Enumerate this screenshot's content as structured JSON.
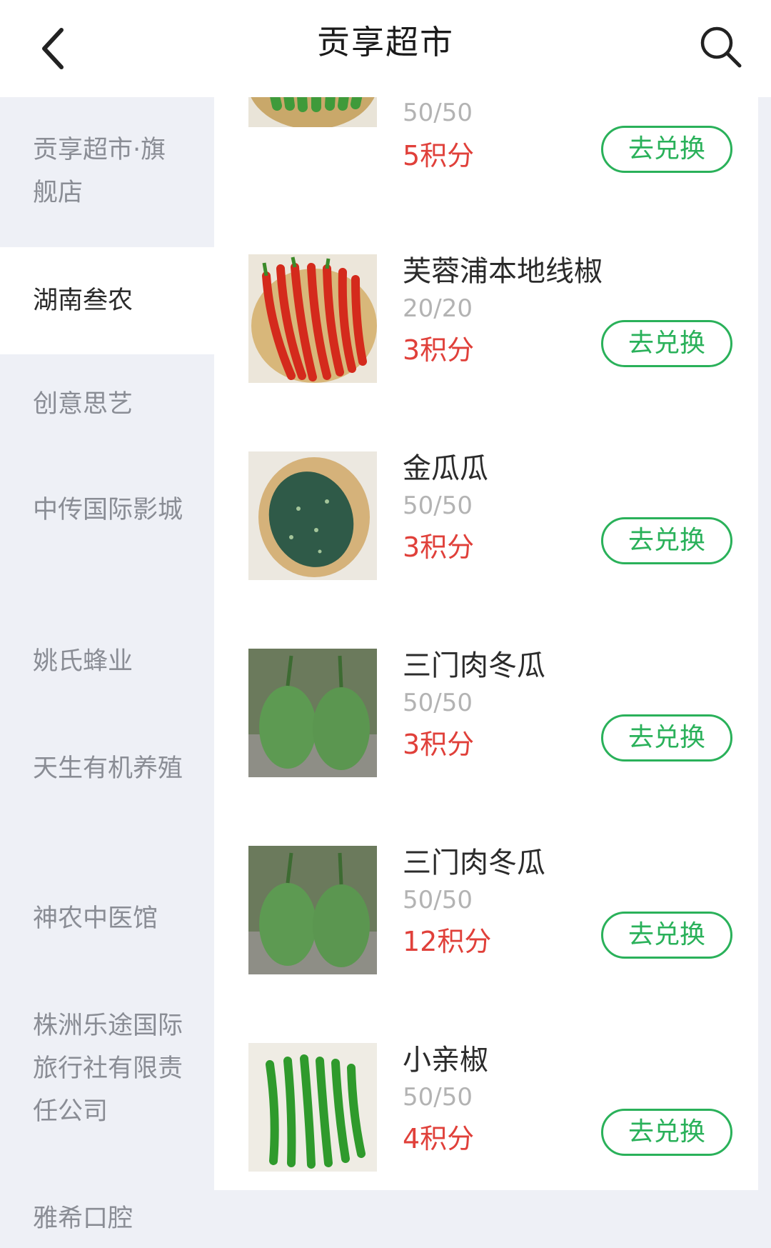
{
  "header": {
    "title": "贡享超市",
    "back_icon": "chevron-left-icon",
    "search_icon": "search-icon"
  },
  "sidebar": {
    "items": [
      {
        "label": "贡享超市·旗舰店",
        "active": false
      },
      {
        "label": "湖南叁农",
        "active": true
      },
      {
        "label": "创意思艺",
        "active": false
      },
      {
        "label": "中传国际影城",
        "active": false
      },
      {
        "label": "姚氏蜂业",
        "active": false
      },
      {
        "label": "天生有机养殖",
        "active": false
      },
      {
        "label": "神农中医馆",
        "active": false
      },
      {
        "label": "株洲乐途国际旅行社有限责任公司",
        "active": false
      },
      {
        "label": "雅希口腔",
        "active": false
      }
    ]
  },
  "products": [
    {
      "name": "",
      "stock": "50/50",
      "points": "5积分",
      "button": "去兑换",
      "image": "okra"
    },
    {
      "name": "芙蓉浦本地线椒",
      "stock": "20/20",
      "points": "3积分",
      "button": "去兑换",
      "image": "red-chili"
    },
    {
      "name": "金瓜瓜",
      "stock": "50/50",
      "points": "3积分",
      "button": "去兑换",
      "image": "squash"
    },
    {
      "name": "三门肉冬瓜",
      "stock": "50/50",
      "points": "3积分",
      "button": "去兑换",
      "image": "winter-melon"
    },
    {
      "name": "三门肉冬瓜",
      "stock": "50/50",
      "points": "12积分",
      "button": "去兑换",
      "image": "winter-melon"
    },
    {
      "name": "小亲椒",
      "stock": "50/50",
      "points": "4积分",
      "button": "去兑换",
      "image": "green-chili"
    }
  ],
  "colors": {
    "accent": "#2ab15a",
    "points": "#e0403a",
    "sidebar_bg": "#eef0f6"
  }
}
